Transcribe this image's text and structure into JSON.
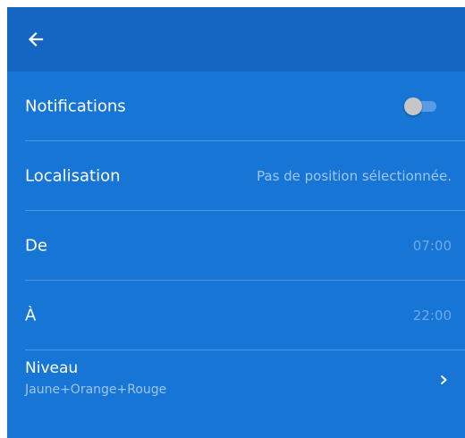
{
  "appbar": {
    "back_icon": "arrow-left-icon"
  },
  "settings": {
    "notifications": {
      "label": "Notifications",
      "enabled": false
    },
    "location": {
      "label": "Localisation",
      "value": "Pas de position sélectionnée."
    },
    "from": {
      "label": "De",
      "value": "07:00"
    },
    "to": {
      "label": "À",
      "value": "22:00"
    },
    "level": {
      "label": "Niveau",
      "value": "Jaune+Orange+Rouge",
      "chevron_icon": "chevron-right-icon"
    }
  },
  "colors": {
    "background": "#1775d6",
    "appbar": "#1565c2",
    "divider": "#4e97e2",
    "secondary_text": "#9ec6f1"
  }
}
